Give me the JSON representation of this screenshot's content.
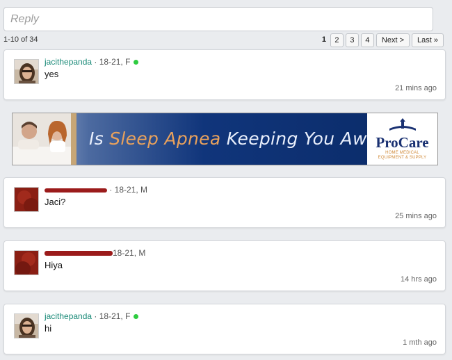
{
  "reply": {
    "placeholder": "Reply"
  },
  "pagination": {
    "range_text": "1-10 of 34",
    "pages": [
      "1",
      "2",
      "3",
      "4"
    ],
    "current": "1",
    "next_label": "Next >",
    "last_label": "Last »"
  },
  "ad": {
    "headline_part1": "Is ",
    "headline_highlight": "Sleep Apnea",
    "headline_part2": " Keeping You Awake?",
    "brand_name": "ProCare",
    "brand_sub_line1": "HOME MEDICAL",
    "brand_sub_line2": "EQUIPMENT & SUPPLY",
    "colors": {
      "headline": "#e8eefb",
      "highlight": "#e8a15c",
      "brand": "#1a3172",
      "sub": "#d08a38"
    }
  },
  "posts": [
    {
      "username": "jacithepanda",
      "meta": " · 18-21, F",
      "online": true,
      "message": "yes",
      "time": "21 mins ago"
    },
    {
      "username": "",
      "meta": " · 18-21, M",
      "online": false,
      "message": "Jaci?",
      "time": "25 mins ago"
    },
    {
      "username": "",
      "meta": "18-21, M",
      "online": false,
      "message": "Hiya",
      "time": "14 hrs ago"
    },
    {
      "username": "jacithepanda",
      "meta": " · 18-21, F",
      "online": true,
      "message": "hi",
      "time": "1 mth ago"
    }
  ],
  "colors": {
    "username": "#1a8a78",
    "online": "#2ecc40",
    "redaction": "#9b1b1b",
    "background": "#eaecef"
  }
}
